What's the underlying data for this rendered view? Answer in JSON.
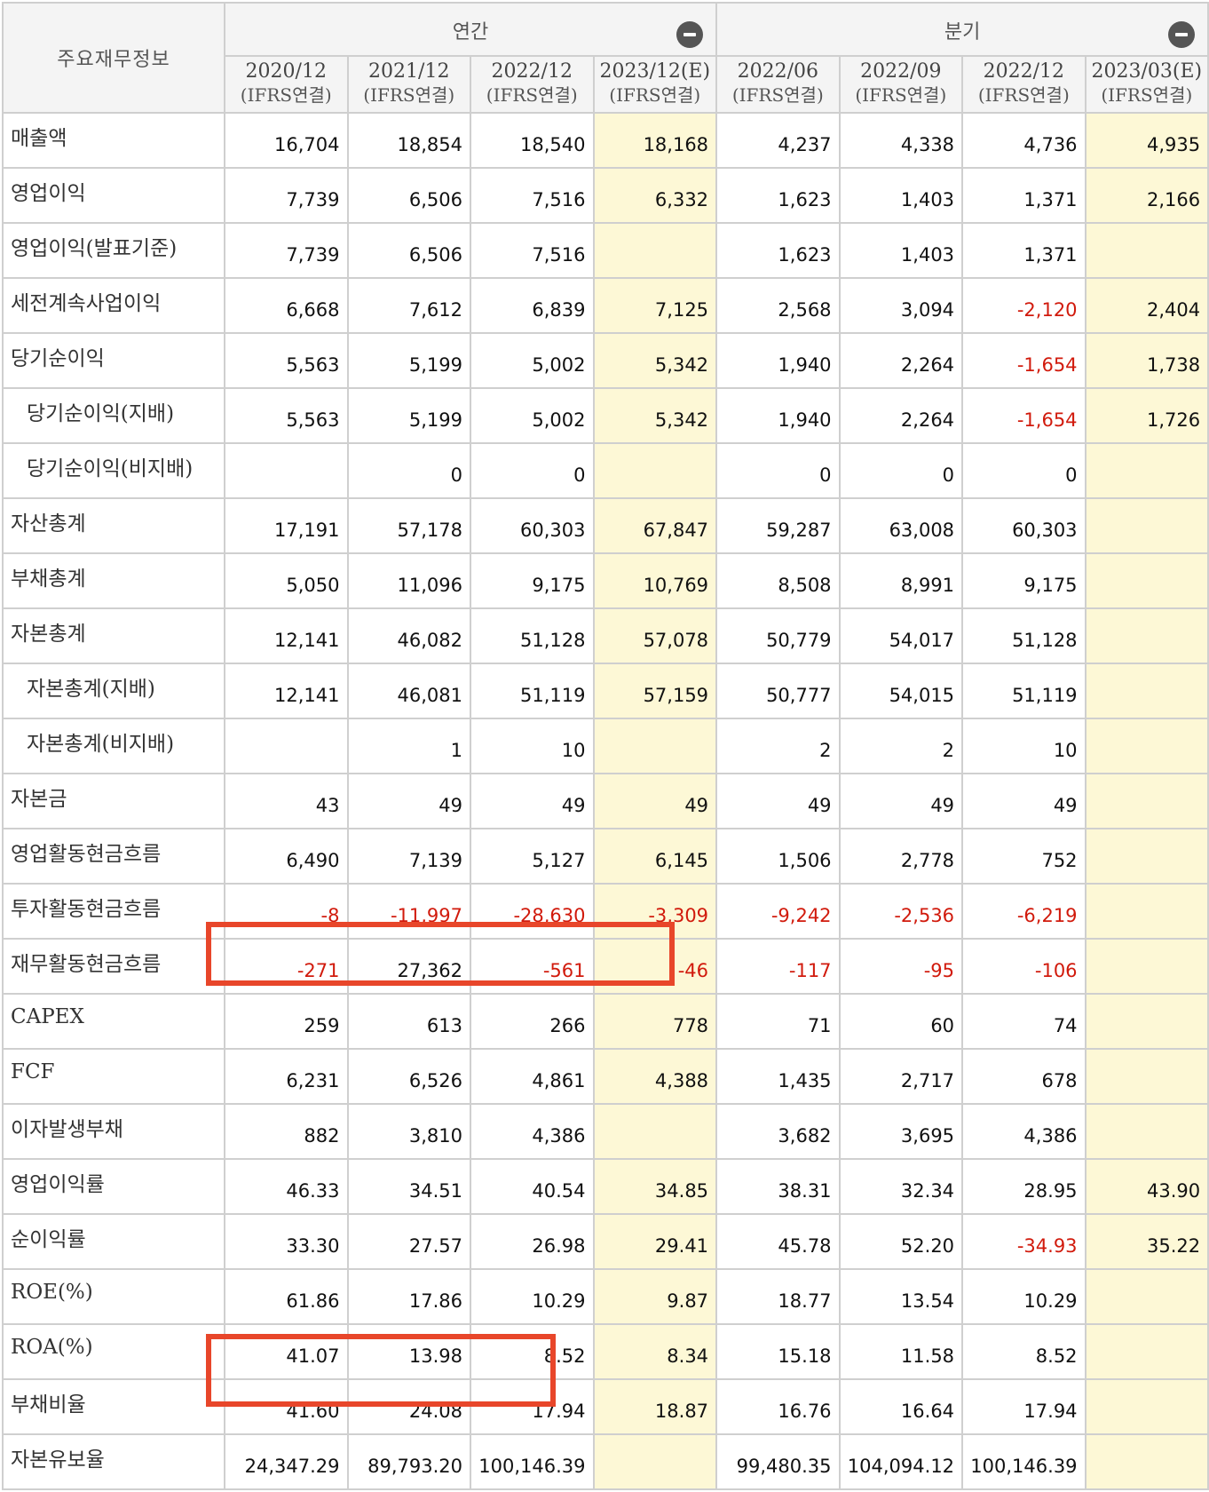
{
  "header": {
    "label": "주요재무정보",
    "annual_group": "연간",
    "quarter_group": "분기",
    "periods": [
      {
        "date": "2020/12",
        "sub": "(IFRS연결)"
      },
      {
        "date": "2021/12",
        "sub": "(IFRS연결)"
      },
      {
        "date": "2022/12",
        "sub": "(IFRS연결)"
      },
      {
        "date": "2023/12(E)",
        "sub": "(IFRS연결)"
      },
      {
        "date": "2022/06",
        "sub": "(IFRS연결)"
      },
      {
        "date": "2022/09",
        "sub": "(IFRS연결)"
      },
      {
        "date": "2022/12",
        "sub": "(IFRS연결)"
      },
      {
        "date": "2023/03(E)",
        "sub": "(IFRS연결)"
      }
    ]
  },
  "rows": [
    {
      "label": "매출액",
      "values": [
        "16,704",
        "18,854",
        "18,540",
        "18,168",
        "4,237",
        "4,338",
        "4,736",
        "4,935"
      ]
    },
    {
      "label": "영업이익",
      "values": [
        "7,739",
        "6,506",
        "7,516",
        "6,332",
        "1,623",
        "1,403",
        "1,371",
        "2,166"
      ]
    },
    {
      "label": "영업이익(발표기준)",
      "values": [
        "7,739",
        "6,506",
        "7,516",
        "",
        "1,623",
        "1,403",
        "1,371",
        ""
      ]
    },
    {
      "label": "세전계속사업이익",
      "values": [
        "6,668",
        "7,612",
        "6,839",
        "7,125",
        "2,568",
        "3,094",
        "-2,120",
        "2,404"
      ]
    },
    {
      "label": "당기순이익",
      "values": [
        "5,563",
        "5,199",
        "5,002",
        "5,342",
        "1,940",
        "2,264",
        "-1,654",
        "1,738"
      ]
    },
    {
      "label": "당기순이익(지배)",
      "values": [
        "5,563",
        "5,199",
        "5,002",
        "5,342",
        "1,940",
        "2,264",
        "-1,654",
        "1,726"
      ]
    },
    {
      "label": "당기순이익(비지배)",
      "values": [
        "",
        "0",
        "0",
        "",
        "0",
        "0",
        "0",
        ""
      ]
    },
    {
      "label": "자산총계",
      "values": [
        "17,191",
        "57,178",
        "60,303",
        "67,847",
        "59,287",
        "63,008",
        "60,303",
        ""
      ]
    },
    {
      "label": "부채총계",
      "values": [
        "5,050",
        "11,096",
        "9,175",
        "10,769",
        "8,508",
        "8,991",
        "9,175",
        ""
      ]
    },
    {
      "label": "자본총계",
      "values": [
        "12,141",
        "46,082",
        "51,128",
        "57,078",
        "50,779",
        "54,017",
        "51,128",
        ""
      ]
    },
    {
      "label": "자본총계(지배)",
      "values": [
        "12,141",
        "46,081",
        "51,119",
        "57,159",
        "50,777",
        "54,015",
        "51,119",
        ""
      ]
    },
    {
      "label": "자본총계(비지배)",
      "values": [
        "",
        "1",
        "10",
        "",
        "2",
        "2",
        "10",
        ""
      ]
    },
    {
      "label": "자본금",
      "values": [
        "43",
        "49",
        "49",
        "49",
        "49",
        "49",
        "49",
        ""
      ]
    },
    {
      "label": "영업활동현금흐름",
      "values": [
        "6,490",
        "7,139",
        "5,127",
        "6,145",
        "1,506",
        "2,778",
        "752",
        ""
      ]
    },
    {
      "label": "투자활동현금흐름",
      "values": [
        "-8",
        "-11,997",
        "-28,630",
        "-3,309",
        "-9,242",
        "-2,536",
        "-6,219",
        ""
      ]
    },
    {
      "label": "재무활동현금흐름",
      "values": [
        "-271",
        "27,362",
        "-561",
        "-46",
        "-117",
        "-95",
        "-106",
        ""
      ]
    },
    {
      "label": "CAPEX",
      "values": [
        "259",
        "613",
        "266",
        "778",
        "71",
        "60",
        "74",
        ""
      ]
    },
    {
      "label": "FCF",
      "values": [
        "6,231",
        "6,526",
        "4,861",
        "4,388",
        "1,435",
        "2,717",
        "678",
        ""
      ]
    },
    {
      "label": "이자발생부채",
      "values": [
        "882",
        "3,810",
        "4,386",
        "",
        "3,682",
        "3,695",
        "4,386",
        ""
      ]
    },
    {
      "label": "영업이익률",
      "values": [
        "46.33",
        "34.51",
        "40.54",
        "34.85",
        "38.31",
        "32.34",
        "28.95",
        "43.90"
      ]
    },
    {
      "label": "순이익률",
      "values": [
        "33.30",
        "27.57",
        "26.98",
        "29.41",
        "45.78",
        "52.20",
        "-34.93",
        "35.22"
      ]
    },
    {
      "label": "ROE(%)",
      "values": [
        "61.86",
        "17.86",
        "10.29",
        "9.87",
        "18.77",
        "13.54",
        "10.29",
        ""
      ]
    },
    {
      "label": "ROA(%)",
      "values": [
        "41.07",
        "13.98",
        "8.52",
        "8.34",
        "15.18",
        "11.58",
        "8.52",
        ""
      ]
    },
    {
      "label": "부채비율",
      "values": [
        "41.60",
        "24.08",
        "17.94",
        "18.87",
        "16.76",
        "16.64",
        "17.94",
        ""
      ]
    },
    {
      "label": "자본유보율",
      "values": [
        "24,347.29",
        "89,793.20",
        "100,146.39",
        "",
        "99,480.35",
        "104,094.12",
        "100,146.39",
        ""
      ]
    }
  ],
  "colors": {
    "negative": "#d11a0c",
    "estimate_bg": "#fdf8d6",
    "highlight": "#e8462a"
  }
}
